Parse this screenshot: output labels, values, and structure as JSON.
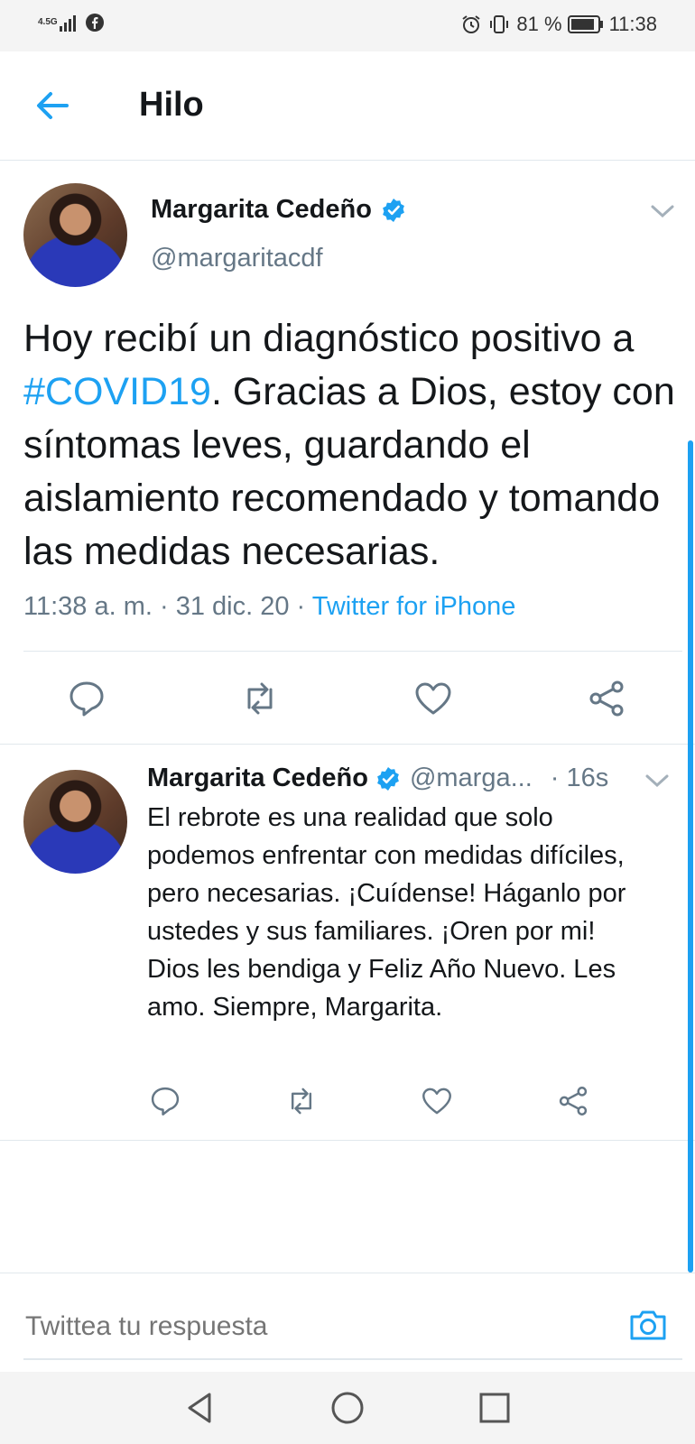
{
  "status_bar": {
    "network": "4.5G",
    "battery": "81 %",
    "time": "11:38"
  },
  "header": {
    "title": "Hilo"
  },
  "main_tweet": {
    "author_name": "Margarita Cedeño",
    "handle": "@margaritacdf",
    "text_before": "Hoy recibí un diagnóstico positivo a ",
    "hashtag": "#COVID19",
    "text_after": ". Gracias a Dios, estoy con síntomas leves, guardando el aislamiento recomendado y tomando las medidas necesarias.",
    "timestamp": "11:38 a. m. · 31 dic. 20 · ",
    "source": "Twitter for iPhone"
  },
  "reply_tweet": {
    "author_name": "Margarita Cedeño",
    "handle": "@marga...",
    "time": "· 16s",
    "text": "El rebrote es una realidad que solo podemos enfrentar con medidas difíciles, pero necesarias. ¡Cuídense! Háganlo por ustedes y sus familiares. ¡Oren por mi! Dios les bendiga y Feliz Año Nuevo. Les amo. Siempre, Margarita."
  },
  "composer": {
    "placeholder": "Twittea tu respuesta"
  },
  "icons": {
    "back": "arrow-left-icon",
    "verified": "verified-badge-icon",
    "reply": "reply-icon",
    "retweet": "retweet-icon",
    "like": "heart-icon",
    "share": "share-icon",
    "camera": "camera-icon"
  },
  "colors": {
    "accent": "#1da1f2",
    "text": "#14171a",
    "secondary": "#657786",
    "divider": "#e1e8ed"
  }
}
